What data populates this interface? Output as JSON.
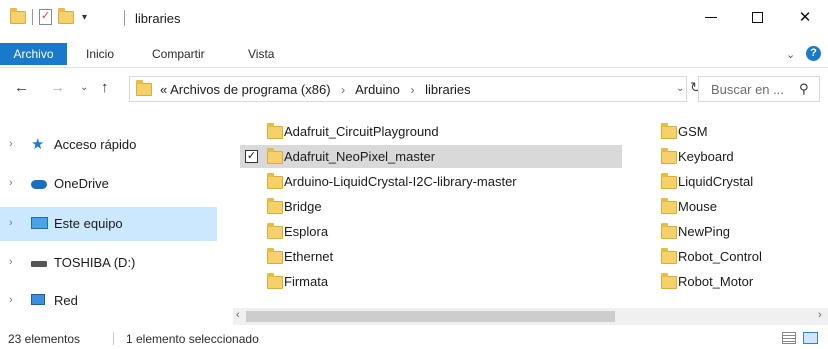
{
  "window": {
    "title": "libraries"
  },
  "ribbon": {
    "tabs": [
      "Archivo",
      "Inicio",
      "Compartir",
      "Vista"
    ],
    "accent": "#1979ca"
  },
  "address": {
    "overflow": "«",
    "crumbs": [
      "Archivos de programa (x86)",
      "Arduino",
      "libraries"
    ]
  },
  "search": {
    "placeholder": "Buscar en ..."
  },
  "sidebar": {
    "items": [
      {
        "label": "Acceso rápido",
        "icon": "star-icon"
      },
      {
        "label": "OneDrive",
        "icon": "cloud-icon"
      },
      {
        "label": "Este equipo",
        "icon": "computer-icon",
        "selected": true
      },
      {
        "label": "TOSHIBA (D:)",
        "icon": "drive-icon"
      },
      {
        "label": "Red",
        "icon": "network-icon"
      }
    ],
    "selected_color": "#cce8ff"
  },
  "files": {
    "column1": [
      "Adafruit_CircuitPlayground",
      "Adafruit_NeoPixel_master",
      "Arduino-LiquidCrystal-I2C-library-master",
      "Bridge",
      "Esplora",
      "Ethernet",
      "Firmata"
    ],
    "column2": [
      "GSM",
      "Keyboard",
      "LiquidCrystal",
      "Mouse",
      "NewPing",
      "Robot_Control",
      "Robot_Motor"
    ],
    "selected": "Adafruit_NeoPixel_master"
  },
  "status": {
    "count": "23 elementos",
    "selection": "1 elemento seleccionado"
  }
}
